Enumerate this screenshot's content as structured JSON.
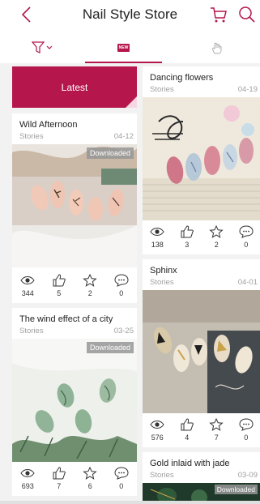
{
  "header": {
    "title": "Nail Style Store",
    "back_icon": "chevron-left-icon",
    "cart_icon": "cart-icon",
    "search_icon": "search-icon"
  },
  "tabs": {
    "filter_icon": "filter-icon",
    "new_badge": "NEW",
    "hot_icon": "hand-icon",
    "accent": "#b5174d"
  },
  "latest_label": "Latest",
  "cards": {
    "wild_afternoon": {
      "title": "Wild Afternoon",
      "category": "Stories",
      "date": "04-12",
      "downloaded": "Downloaded",
      "views": "344",
      "likes": "5",
      "favorites": "2",
      "comments": "0"
    },
    "wind_effect": {
      "title": "The wind effect of a city",
      "category": "Stories",
      "date": "03-25",
      "downloaded": "Downloaded",
      "views": "693",
      "likes": "7",
      "favorites": "6",
      "comments": "0"
    },
    "dancing_flowers": {
      "title": "Dancing flowers",
      "category": "Stories",
      "date": "04-19",
      "views": "138",
      "likes": "3",
      "favorites": "2",
      "comments": "0"
    },
    "sphinx": {
      "title": "Sphinx",
      "category": "Stories",
      "date": "04-01",
      "views": "576",
      "likes": "4",
      "favorites": "7",
      "comments": "0"
    },
    "gold_inlaid": {
      "title": "Gold inlaid with jade",
      "category": "Stories",
      "date": "03-09",
      "downloaded": "Downloaded"
    }
  }
}
